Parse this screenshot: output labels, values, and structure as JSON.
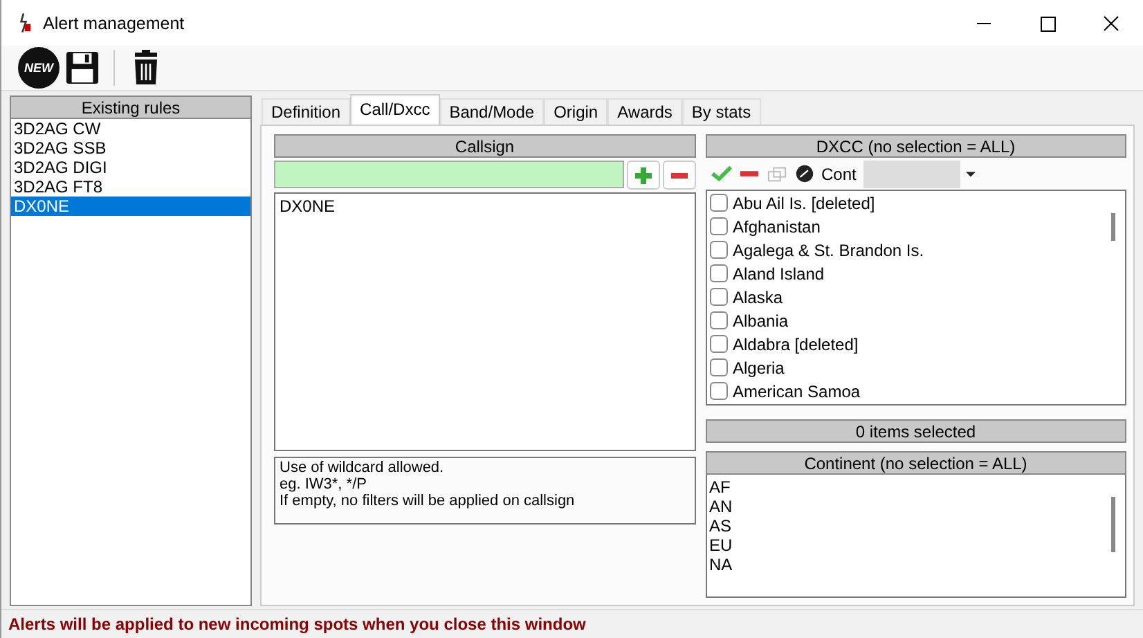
{
  "window": {
    "title": "Alert management"
  },
  "toolbar": {
    "new_badge": "NEW"
  },
  "rules": {
    "header": "Existing rules",
    "items": [
      {
        "label": "3D2AG CW",
        "selected": false
      },
      {
        "label": "3D2AG SSB",
        "selected": false
      },
      {
        "label": "3D2AG DIGI",
        "selected": false
      },
      {
        "label": "3D2AG FT8",
        "selected": false
      },
      {
        "label": "DX0NE",
        "selected": true
      }
    ]
  },
  "tabs": [
    {
      "label": "Definition",
      "selected": false
    },
    {
      "label": "Call/Dxcc",
      "selected": true
    },
    {
      "label": "Band/Mode",
      "selected": false
    },
    {
      "label": "Origin",
      "selected": false
    },
    {
      "label": "Awards",
      "selected": false
    },
    {
      "label": "By stats",
      "selected": false
    }
  ],
  "callsign": {
    "header": "Callsign",
    "items": [
      "DX0NE"
    ],
    "help": [
      "Use of wildcard allowed.",
      "eg. IW3*, */P",
      "If empty, no filters will be applied on callsign"
    ]
  },
  "dxcc": {
    "header": "DXCC (no selection = ALL)",
    "cont_label": "Cont",
    "items": [
      {
        "label": "Abu Ail Is. [deleted]",
        "checked": false
      },
      {
        "label": "Afghanistan",
        "checked": false
      },
      {
        "label": "Agalega & St. Brandon Is.",
        "checked": false
      },
      {
        "label": "Aland Island",
        "checked": false
      },
      {
        "label": "Alaska",
        "checked": false
      },
      {
        "label": "Albania",
        "checked": false
      },
      {
        "label": "Aldabra [deleted]",
        "checked": false
      },
      {
        "label": "Algeria",
        "checked": false
      },
      {
        "label": "American Samoa",
        "checked": false
      }
    ],
    "count": "0 items selected"
  },
  "continent": {
    "header": "Continent (no selection = ALL)",
    "items": [
      "AF",
      "AN",
      "AS",
      "EU",
      "NA"
    ]
  },
  "status_bar": "Alerts will be applied to new incoming spots when you close this window"
}
